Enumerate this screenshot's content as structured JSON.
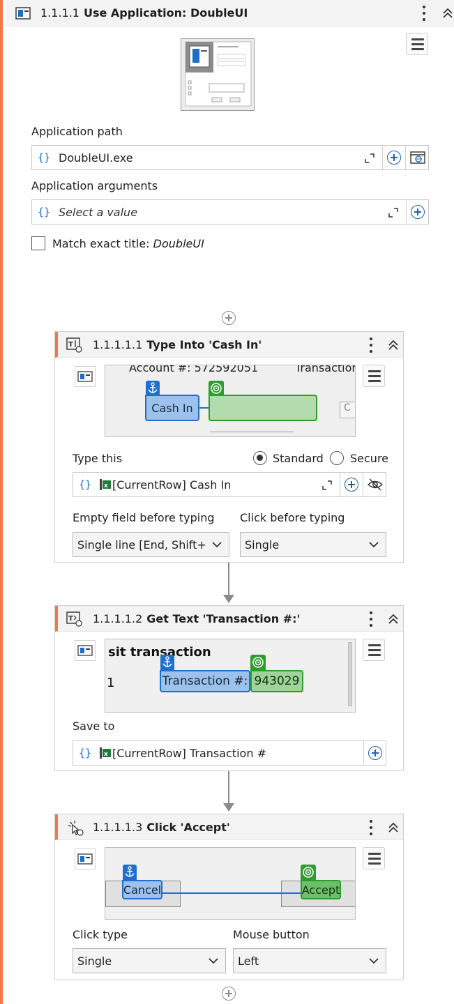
{
  "outer": {
    "number": "1.1.1.1",
    "title": "Use Application: DoubleUI",
    "app_path_label": "Application path",
    "app_path_value": "DoubleUI.exe",
    "app_args_label": "Application arguments",
    "app_args_placeholder": "Select a value",
    "match_title_label": "Match exact title:",
    "match_title_value": "DoubleUI",
    "match_title_checked": false
  },
  "type_into": {
    "number": "1.1.1.1.1",
    "title": "Type Into 'Cash In'",
    "shot_text_account": "Account #: 572592051",
    "shot_text_transaction": "Transaction",
    "shot_anchor_label": "Cash In",
    "type_this_label": "Type this",
    "radio_standard": "Standard",
    "radio_secure": "Secure",
    "selected_mode": "Standard",
    "type_value_tag": "[CurrentRow]",
    "type_value_col": "Cash In",
    "empty_field_label": "Empty field before typing",
    "empty_field_value": "Single line [End, Shift+Home]",
    "click_before_label": "Click before typing",
    "click_before_value": "Single"
  },
  "get_text": {
    "number": "1.1.1.1.2",
    "title": "Get Text 'Transaction #:'",
    "shot_heading": "sit transaction",
    "shot_digit": "1",
    "shot_anchor_label": "Transaction #:",
    "shot_target_value": "943029",
    "save_to_label": "Save to",
    "save_value_tag": "[CurrentRow]",
    "save_value_col": "Transaction #"
  },
  "click": {
    "number": "1.1.1.1.3",
    "title": "Click 'Accept'",
    "shot_anchor_label": "Cancel",
    "shot_target_label": "Accept",
    "click_type_label": "Click type",
    "click_type_value": "Single",
    "mouse_button_label": "Mouse button",
    "mouse_button_value": "Left"
  },
  "colors": {
    "accent_orange": "#f07a4a",
    "brand_blue": "#1a5fb4",
    "anchor_blue": "#1f6fd1",
    "target_green": "#2e9d2e"
  }
}
